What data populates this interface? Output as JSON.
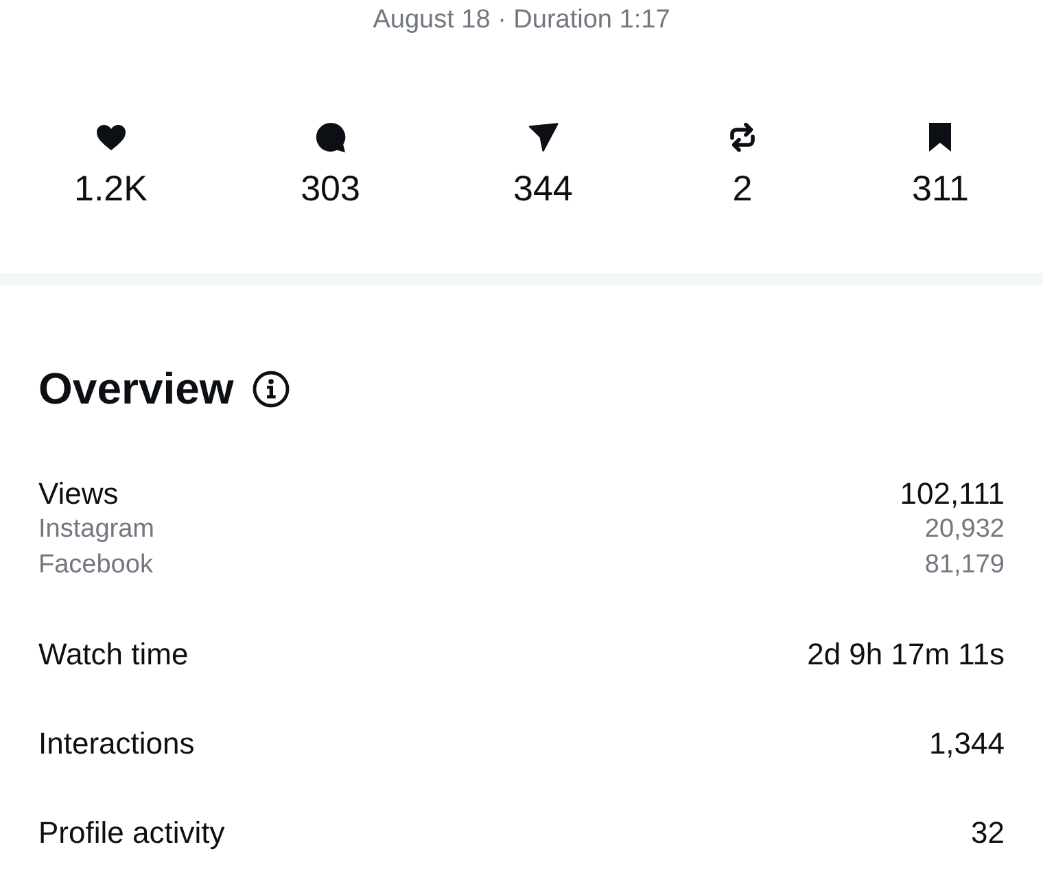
{
  "header": {
    "meta": "August 18 · Duration 1:17"
  },
  "stats": [
    {
      "kind": "like",
      "value": "1.2K"
    },
    {
      "kind": "comment",
      "value": "303"
    },
    {
      "kind": "share",
      "value": "344"
    },
    {
      "kind": "repost",
      "value": "2"
    },
    {
      "kind": "save",
      "value": "311"
    }
  ],
  "overview": {
    "title": "Overview",
    "metrics": [
      {
        "label": "Views",
        "value": "102,111",
        "breakdown": [
          {
            "label": "Instagram",
            "value": "20,932"
          },
          {
            "label": "Facebook",
            "value": "81,179"
          }
        ]
      },
      {
        "label": "Watch time",
        "value": "2d 9h 17m 11s"
      },
      {
        "label": "Interactions",
        "value": "1,344"
      },
      {
        "label": "Profile activity",
        "value": "32"
      }
    ]
  }
}
